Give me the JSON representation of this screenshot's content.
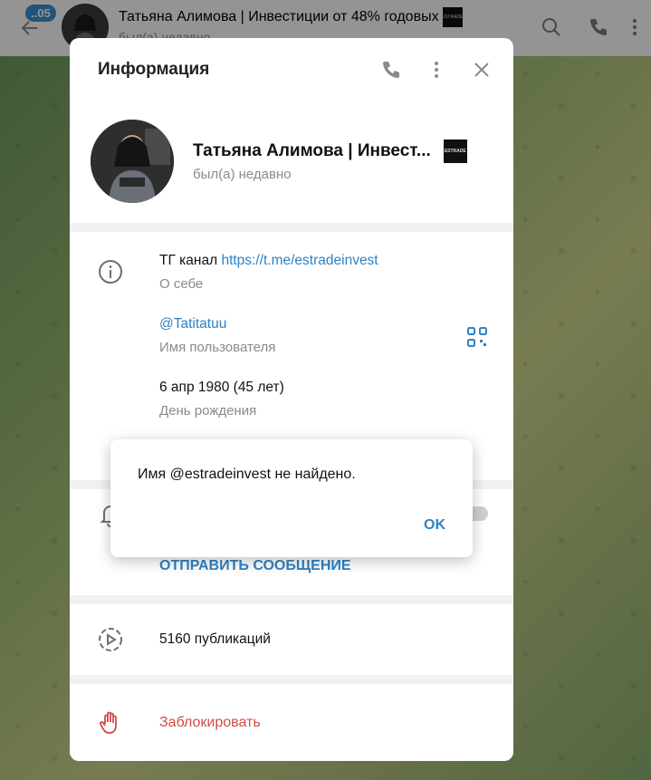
{
  "header": {
    "unread_badge": "..05",
    "title": "Татьяна Алимова | Инвестиции от 48% годовых",
    "status": "был(а) недавно"
  },
  "info_dialog": {
    "title": "Информация",
    "profile": {
      "name": "Татьяна Алимова | Инвест...",
      "status": "был(а) недавно",
      "logo_text": "ESTRADE"
    },
    "bio": {
      "prefix": "ТГ канал ",
      "link": "https://t.me/estradeinvest",
      "label": "О себе"
    },
    "username": {
      "value": "@Tatitatuu",
      "label": "Имя пользователя"
    },
    "birthday": {
      "value": "6 апр 1980 (45 лет)",
      "label": "День рождения"
    },
    "send_message": "ОТПРАВИТЬ СООБЩЕНИЕ",
    "posts": "5160 публикаций",
    "block": "Заблокировать"
  },
  "alert": {
    "message": "Имя @estradeinvest не найдено.",
    "ok": "OK"
  },
  "colors": {
    "accent": "#2f82c4",
    "danger": "#d14a4a",
    "badge": "#3d8fd1"
  }
}
